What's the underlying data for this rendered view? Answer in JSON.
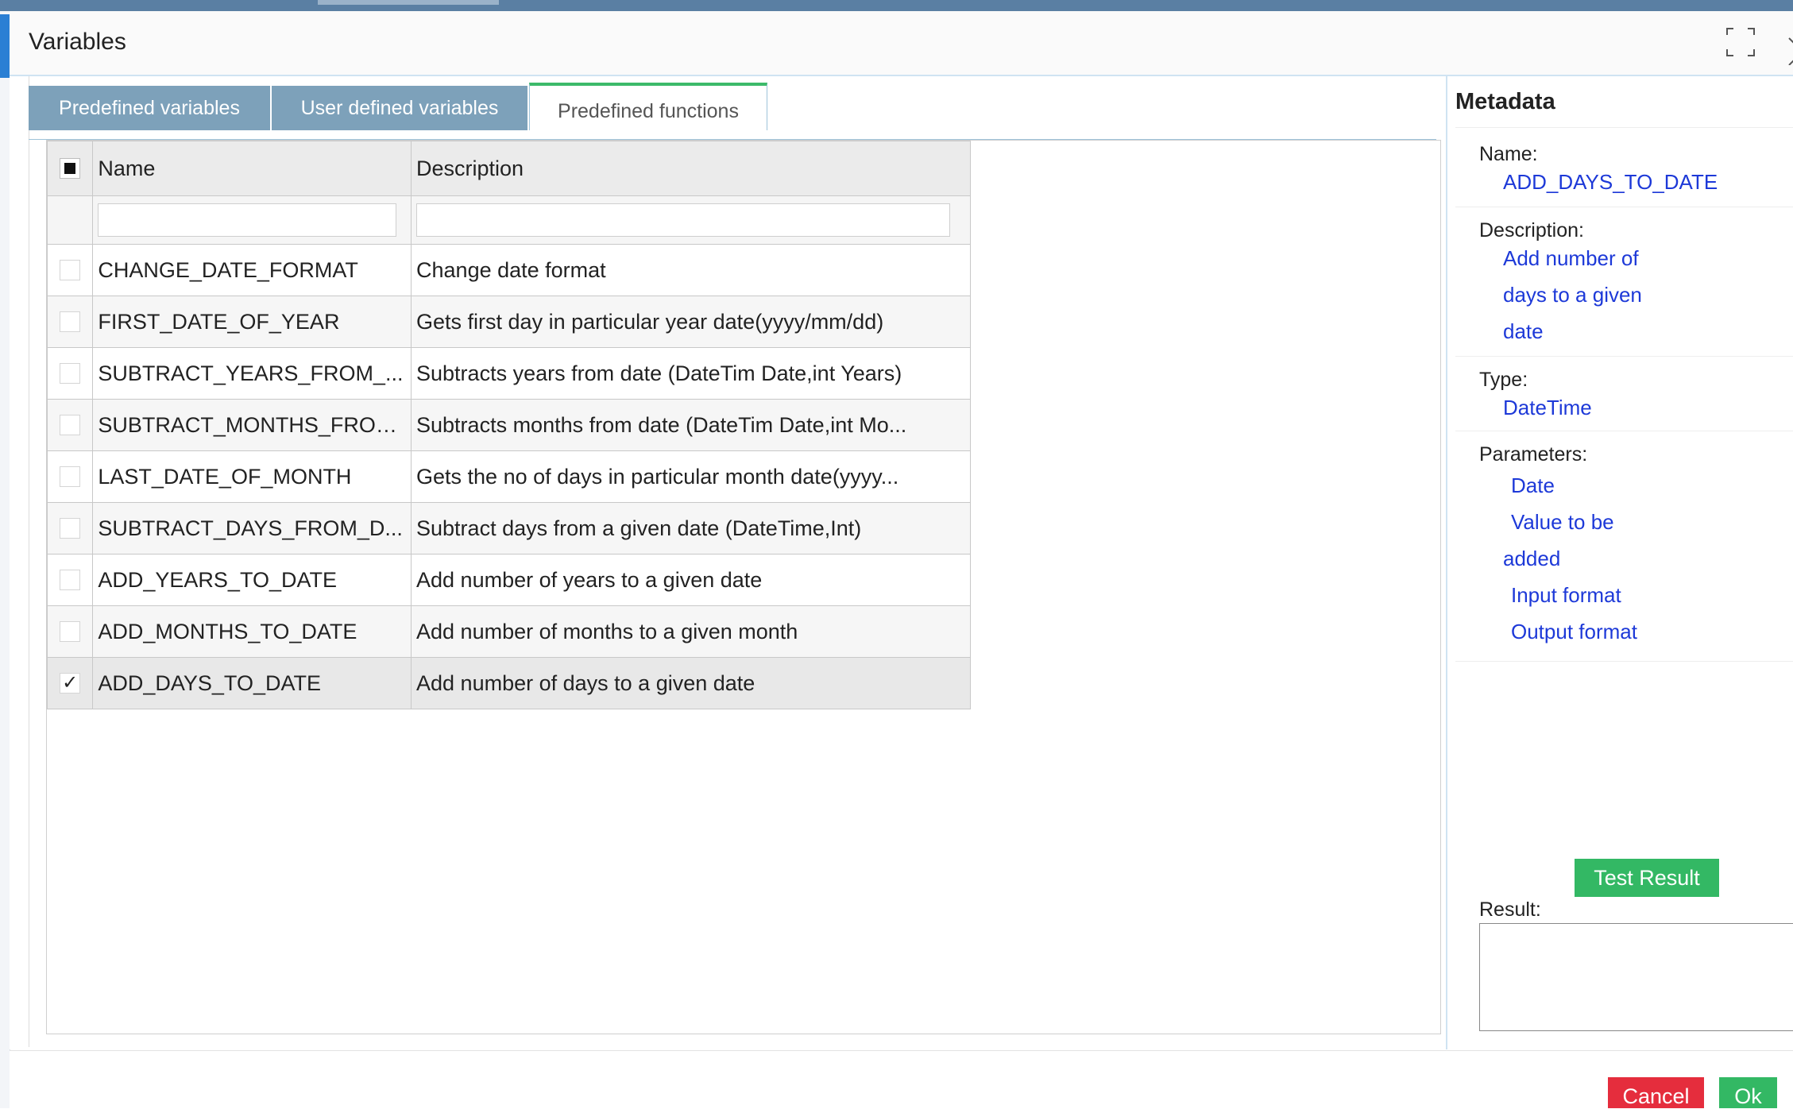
{
  "window": {
    "title": "Variables"
  },
  "tabs": [
    {
      "label": "Predefined variables"
    },
    {
      "label": "User defined variables"
    },
    {
      "label": "Predefined functions"
    }
  ],
  "grid": {
    "columns": {
      "name": "Name",
      "description": "Description"
    },
    "filters": {
      "name": "",
      "description": ""
    },
    "rows": [
      {
        "checked": "",
        "name": "CHANGE_DATE_FORMAT",
        "description": "Change date format"
      },
      {
        "checked": "",
        "name": "FIRST_DATE_OF_YEAR",
        "description": "Gets first day in particular year date(yyyy/mm/dd)"
      },
      {
        "checked": "",
        "name": "SUBTRACT_YEARS_FROM_...",
        "description": "Subtracts years from date (DateTim Date,int Years)"
      },
      {
        "checked": "",
        "name": "SUBTRACT_MONTHS_FROM...",
        "description": "Subtracts months from date (DateTim Date,int Mo..."
      },
      {
        "checked": "",
        "name": "LAST_DATE_OF_MONTH",
        "description": "Gets the no of days in particular month date(yyyy..."
      },
      {
        "checked": "",
        "name": "SUBTRACT_DAYS_FROM_D...",
        "description": "Subtract days from a given date (DateTime,Int)"
      },
      {
        "checked": "",
        "name": "ADD_YEARS_TO_DATE",
        "description": "Add number of years to a given date"
      },
      {
        "checked": "",
        "name": "ADD_MONTHS_TO_DATE",
        "description": "Add number of months to a given month"
      },
      {
        "checked": "✓",
        "name": "ADD_DAYS_TO_DATE",
        "description": "Add number of days to a given date"
      }
    ]
  },
  "metadata": {
    "title": "Metadata",
    "name_label": "Name:",
    "name_value": "ADD_DAYS_TO_DATE",
    "description_label": "Description:",
    "description_lines": [
      "Add number of",
      "days to a given",
      "date"
    ],
    "type_label": "Type:",
    "type_value": "DateTime",
    "parameters_label": "Parameters:",
    "parameters": [
      "Date",
      "Value to be",
      "added",
      "Input format",
      "Output format"
    ],
    "test_button": "Test Result",
    "result_label": "Result:"
  },
  "footer": {
    "cancel_label": "Cancel",
    "ok_label": "Ok"
  },
  "icons": {
    "maximize": "maximize-icon",
    "close": "close-icon"
  },
  "colors": {
    "accent_green": "#33b864",
    "danger_red": "#e52d3d",
    "tab_blue": "#7da1ba",
    "link_blue": "#1d39d8"
  }
}
